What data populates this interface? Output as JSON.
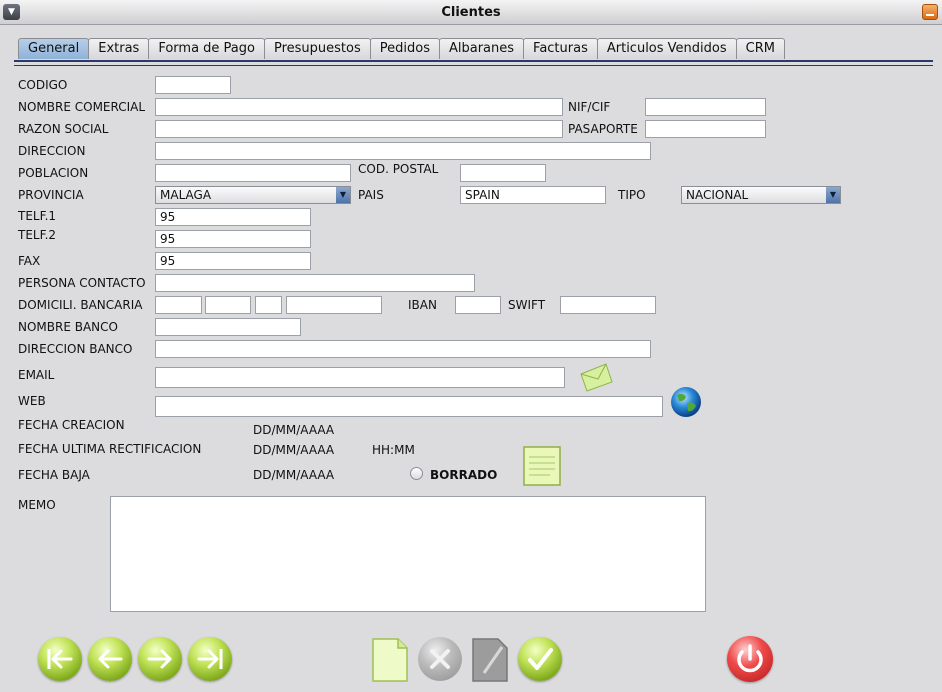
{
  "window": {
    "title": "Clientes"
  },
  "tabs": [
    "General",
    "Extras",
    "Forma de Pago",
    "Presupuestos",
    "Pedidos",
    "Albaranes",
    "Facturas",
    "Articulos Vendidos",
    "CRM"
  ],
  "labels": {
    "codigo": "CODIGO",
    "nombre_comercial": "NOMBRE COMERCIAL",
    "nif_cif": "NIF/CIF",
    "razon_social": "RAZON SOCIAL",
    "pasaporte": "PASAPORTE",
    "direccion": "DIRECCION",
    "poblacion": "POBLACION",
    "cod_postal": "COD. POSTAL",
    "provincia": "PROVINCIA",
    "pais": "PAIS",
    "tipo": "TIPO",
    "telf1": "TELF.1",
    "telf2": "TELF.2",
    "fax": "FAX",
    "persona_contacto": "PERSONA CONTACTO",
    "domicili_bancaria": "DOMICILI. BANCARIA",
    "iban": "IBAN",
    "swift": "SWIFT",
    "nombre_banco": "NOMBRE BANCO",
    "direccion_banco": "DIRECCION BANCO",
    "email": "EMAIL",
    "web": "WEB",
    "fecha_creacion": "FECHA CREACION",
    "fecha_ultima": "FECHA ULTIMA RECTIFICACION",
    "fecha_baja": "FECHA BAJA",
    "borrado": "BORRADO",
    "memo": "MEMO"
  },
  "values": {
    "codigo": "",
    "nombre_comercial": "",
    "nif_cif": "",
    "razon_social": "",
    "pasaporte": "",
    "direccion": "",
    "poblacion": "",
    "cod_postal": "",
    "provincia": "MALAGA",
    "pais": "SPAIN",
    "tipo": "NACIONAL",
    "telf1": "95",
    "telf2": "95",
    "fax": "95",
    "persona_contacto": "",
    "nombre_banco": "",
    "direccion_banco": "",
    "email": "",
    "web": "",
    "memo": "",
    "fecha_creacion": "DD/MM/AAAA",
    "fecha_ultima": "DD/MM/AAAA",
    "hora_ultima": "HH:MM",
    "fecha_baja": "DD/MM/AAAA"
  },
  "icons": {
    "nav": [
      "first-icon",
      "previous-icon",
      "next-icon",
      "last-icon"
    ],
    "actions": [
      "new-document-icon",
      "cancel-icon",
      "edit-icon",
      "accept-icon",
      "power-icon"
    ]
  }
}
